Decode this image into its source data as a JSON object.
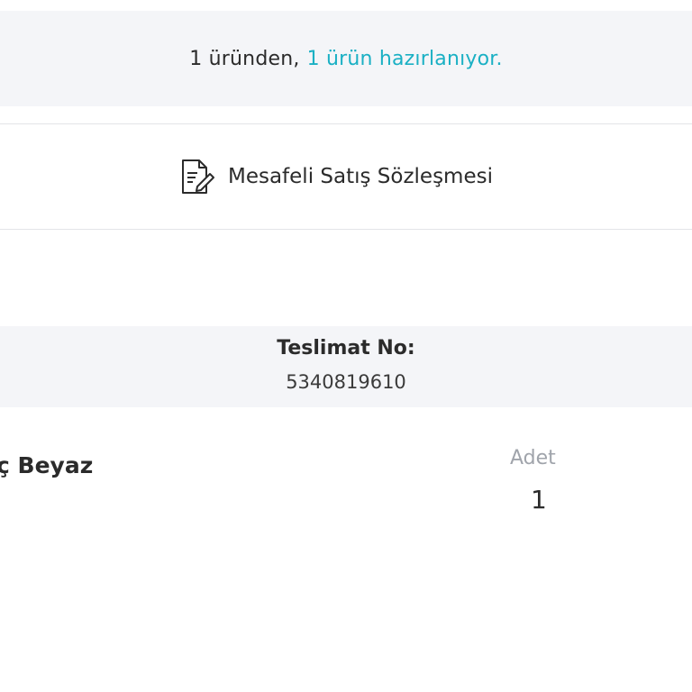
{
  "status": {
    "prefix": "1 üründen,",
    "highlight": "1 ürün hazırlanıyor.",
    "highlight_color": "#1ab0c4"
  },
  "contract": {
    "label": "Mesafeli Satış Sözleşmesi",
    "icon": "document-edit-icon"
  },
  "delivery": {
    "label": "Teslimat No:",
    "number": "5340819610"
  },
  "product": {
    "name_fragment": "ç Beyaz",
    "quantity_label": "Adet",
    "quantity": "1"
  }
}
